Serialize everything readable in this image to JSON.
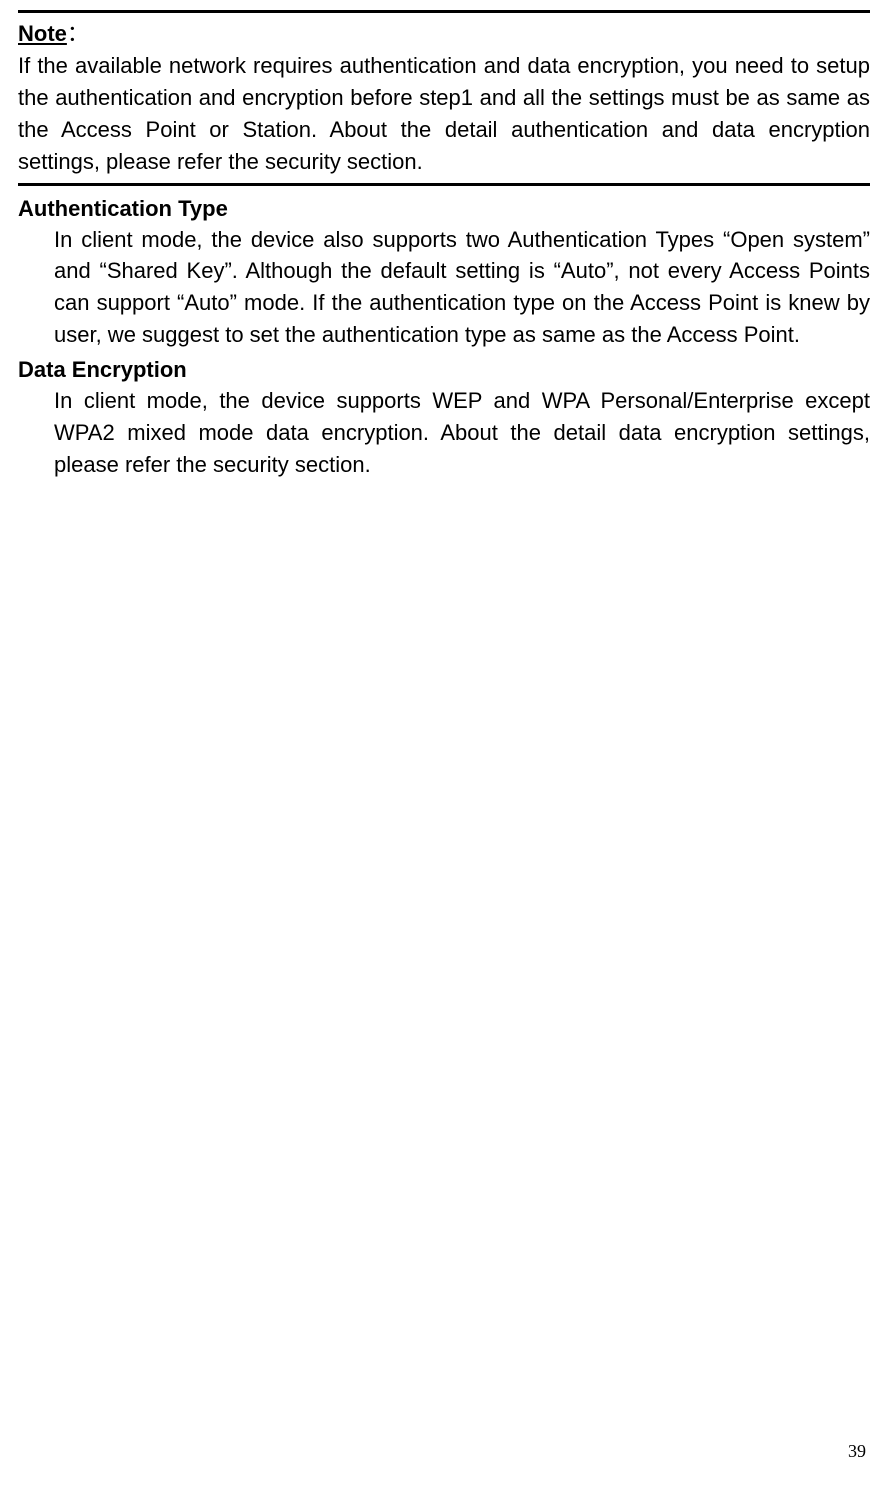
{
  "note": {
    "label": "Note",
    "colon": "：",
    "text": "If the available network requires authentication and data encryption, you need to setup the authentication and encryption before step1 and all the settings must be as same as the Access Point or Station. About the detail authentication and data encryption settings, please refer the security section."
  },
  "sections": {
    "auth": {
      "heading": "Authentication Type",
      "body": "In client mode, the device also supports two Authentication Types “Open system” and “Shared Key”. Although the default setting is “Auto”, not every Access Points can support “Auto” mode. If the authentication type on the Access Point is knew by user, we suggest to set the authentication type as same as the Access Point."
    },
    "encryption": {
      "heading": "Data Encryption",
      "body": "In client mode, the device supports WEP and WPA Personal/Enterprise except WPA2 mixed mode data encryption. About the detail data encryption settings, please refer the security section."
    }
  },
  "page_number": "39"
}
